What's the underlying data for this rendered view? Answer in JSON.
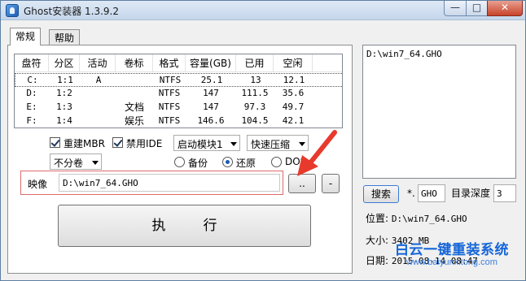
{
  "window": {
    "title": "Ghost安装器 1.3.9.2",
    "min_glyph": "—",
    "max_glyph": "□",
    "close_glyph": "✕"
  },
  "tabs": [
    {
      "label": "常规",
      "active": true
    },
    {
      "label": "帮助",
      "active": false
    }
  ],
  "disk_table": {
    "columns": [
      "盘符",
      "分区",
      "活动",
      "卷标",
      "格式",
      "容量(GB)",
      "已用",
      "空闲"
    ],
    "rows": [
      {
        "drive": "C:",
        "partition": "1:1",
        "active": "A",
        "label": "",
        "format": "NTFS",
        "capacity": "25.1",
        "used": "13",
        "free": "12.1"
      },
      {
        "drive": "D:",
        "partition": "1:2",
        "active": "",
        "label": "",
        "format": "NTFS",
        "capacity": "147",
        "used": "111.5",
        "free": "35.6"
      },
      {
        "drive": "E:",
        "partition": "1:3",
        "active": "",
        "label": "文档",
        "format": "NTFS",
        "capacity": "147",
        "used": "97.3",
        "free": "49.7"
      },
      {
        "drive": "F:",
        "partition": "1:4",
        "active": "",
        "label": "娱乐",
        "format": "NTFS",
        "capacity": "146.6",
        "used": "104.5",
        "free": "42.1"
      }
    ]
  },
  "options": {
    "rebuild_mbr": "重建MBR",
    "disable_ide": "禁用IDE",
    "boot_module": "启动模块1",
    "compression": "快速压缩",
    "split": "不分卷",
    "mode_backup": "备份",
    "mode_restore": "还原",
    "mode_dos": "DOS"
  },
  "image": {
    "label": "映像",
    "path": "D:\\win7_64.GHO",
    "browse_label": "..",
    "minus_label": "-"
  },
  "execute_label": "执行",
  "right_panel": {
    "log_text": "D:\\win7_64.GHO",
    "search_label": "搜索",
    "ext_prefix": "*.",
    "ext_value": "GHO",
    "depth_label": "目录深度",
    "depth_value": "3",
    "location_label": "位置:",
    "location_value": "D:\\win7_64.GHO",
    "size_label": "大小:",
    "size_value": "3402 MB",
    "date_label": "日期:",
    "date_value": "2015-08-14  08:47"
  },
  "watermark": {
    "title": "白云一键重装系统",
    "url": "www.baiyunxitong.com"
  },
  "colors": {
    "accent_red": "#e83a2c",
    "watermark_blue": "#1565d8"
  }
}
